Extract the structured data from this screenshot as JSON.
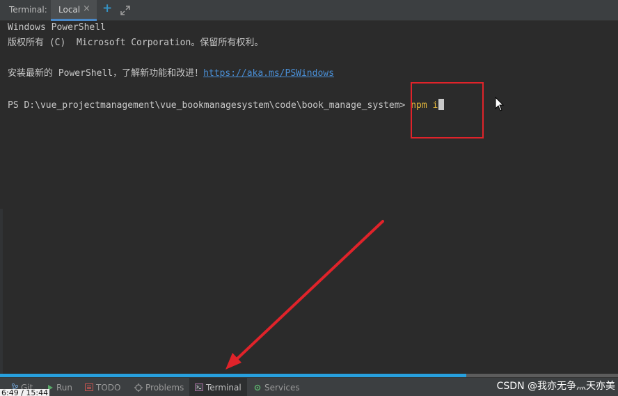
{
  "header": {
    "label": "Terminal:",
    "tab": {
      "label": "Local",
      "close_glyph": "×"
    },
    "add_tab_glyph": "+",
    "expand_icon": "expand-icon"
  },
  "terminal": {
    "lines": [
      "Windows PowerShell",
      "版权所有 (C)  Microsoft Corporation。保留所有权利。",
      "",
      "安装最新的 PowerShell，了解新功能和改进！"
    ],
    "link": "https://aka.ms/PSWindows",
    "prompt": "PS D:\\vue_projectmanagement\\vue_bookmanagesystem\\code\\book_manage_system>",
    "command": "npm i",
    "cursor_visible": true
  },
  "annotation": {
    "box_color": "#e0232a",
    "arrow_color": "#e0232a"
  },
  "progress": {
    "percent": 75.5,
    "color": "#27a0de"
  },
  "toolbar": {
    "items": [
      {
        "label": "Git",
        "icon": "git-branch-icon"
      },
      {
        "label": "Run",
        "icon": "run-icon"
      },
      {
        "label": "TODO",
        "icon": "todo-icon"
      },
      {
        "label": "Problems",
        "icon": "problems-icon"
      },
      {
        "label": "Terminal",
        "icon": "terminal-icon",
        "active": true
      },
      {
        "label": "Services",
        "icon": "services-icon"
      }
    ]
  },
  "overlay": {
    "timestamp": "6:49 / 15:44",
    "watermark": "CSDN @我亦无争灬天亦美"
  },
  "colors": {
    "background": "#2b2b2b",
    "accent": "#4a88c7",
    "command": "#e2b63c",
    "link": "#4a8fd6"
  }
}
